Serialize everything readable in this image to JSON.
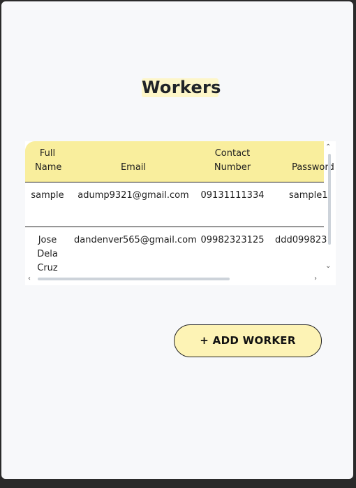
{
  "page": {
    "title": "Workers"
  },
  "table": {
    "headers": {
      "full_name": [
        "Full",
        "Name"
      ],
      "email": "Email",
      "contact": [
        "Contact",
        "Number"
      ],
      "password": "Password"
    },
    "rows": [
      {
        "full_name": [
          "sample"
        ],
        "email": "adump9321@gmail.com",
        "contact": "09131111334",
        "password": "sample1"
      },
      {
        "full_name": [
          "Jose",
          "Dela",
          "Cruz"
        ],
        "email": "dandenver565@gmail.com",
        "contact": "09982323125",
        "password": "ddd099823"
      }
    ]
  },
  "actions": {
    "add_worker": "+ ADD WORKER"
  },
  "icons": {
    "scroll_up": "chevron-up-icon",
    "scroll_down": "chevron-down-icon",
    "scroll_left": "chevron-left-icon",
    "scroll_right": "chevron-right-icon"
  },
  "colors": {
    "header_bg": "#f9ee9d",
    "button_bg": "#fdf3b5",
    "title_bg": "#fdf6c8"
  }
}
